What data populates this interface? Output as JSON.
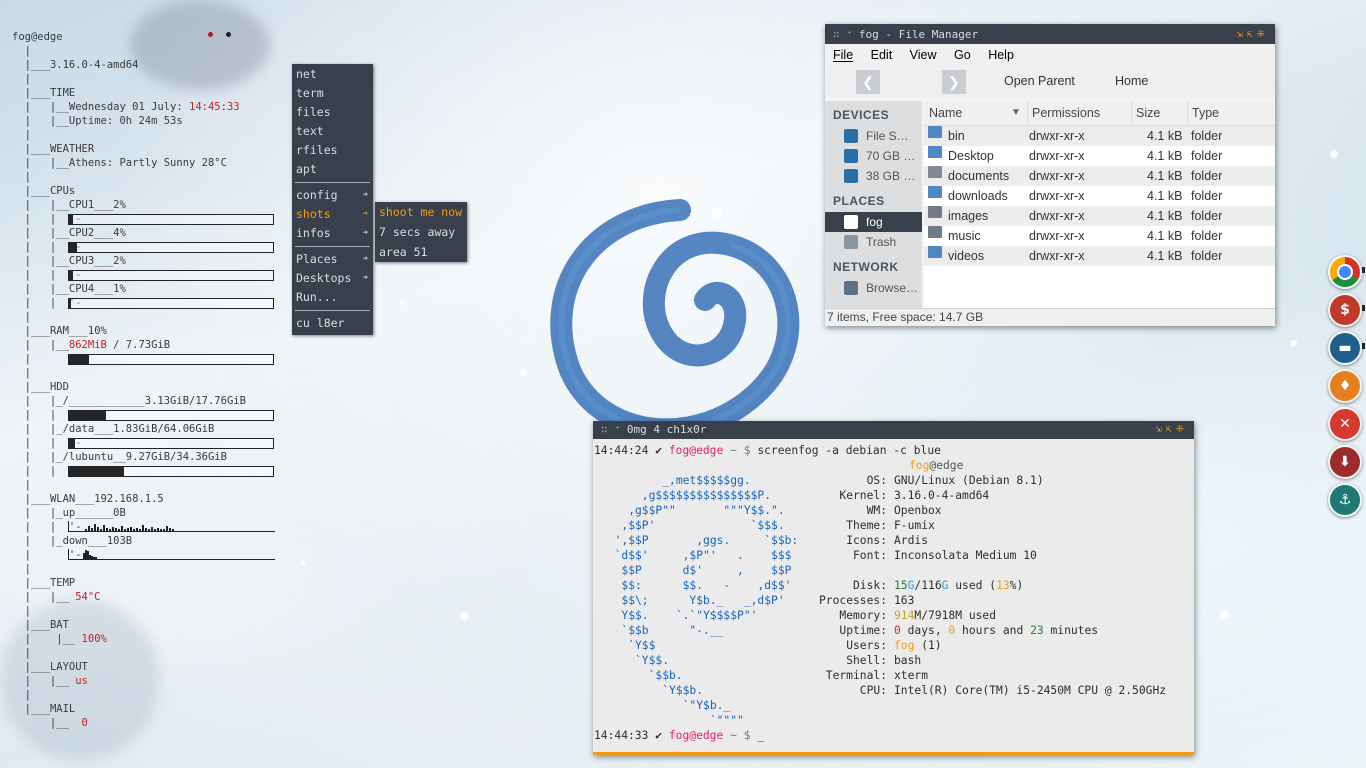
{
  "conky": {
    "host": "fog@edge",
    "kernel": "3.16.0-4-amd64",
    "time_label": "TIME",
    "date_prefix": "Wednesday 01 July: ",
    "time": "14:45:33",
    "uptime": "Uptime: 0h 24m 53s",
    "weather_label": "WEATHER",
    "weather": "Athens: Partly Sunny 28°C",
    "cpus_label": "CPUs",
    "cpus": [
      {
        "label": "CPU1___2%",
        "value": 0.02
      },
      {
        "label": "CPU2___4%",
        "value": 0.04
      },
      {
        "label": "CPU3___2%",
        "value": 0.02
      },
      {
        "label": "CPU4___1%",
        "value": 0.01
      }
    ],
    "ram_label": "RAM___10%",
    "ram_used": "862MiB",
    "ram_total": " / 7.73GiB",
    "ram_value": 0.1,
    "hdd_label": "HDD",
    "disks": [
      {
        "label": "_/____________3.13GiB/17.76GiB",
        "value": 0.18
      },
      {
        "label": "_/data___1.83GiB/64.06GiB",
        "value": 0.03
      },
      {
        "label": "_/lubuntu__9.27GiB/34.36GiB",
        "value": 0.27
      }
    ],
    "wlan_label": "WLAN___192.168.1.5",
    "up_label": "_up______0B",
    "down_label": "_down___103B",
    "temp_label": "TEMP",
    "temp": "54°C",
    "bat_label": "BAT",
    "bat": "100%",
    "layout_label": "LAYOUT",
    "layout": "us",
    "mail_label": "MAIL",
    "mail": "0"
  },
  "menu": {
    "items": [
      "net",
      "term",
      "files",
      "text",
      "rfiles",
      "apt"
    ],
    "sub_items": [
      "config",
      "shots",
      "infos"
    ],
    "places": [
      "Places",
      "Desktops",
      "Run..."
    ],
    "footer": "cu l8er"
  },
  "submenu": {
    "items": [
      "shoot me now",
      "7 secs away",
      "area 51"
    ]
  },
  "file_manager": {
    "title": "fog - File Manager",
    "menus": [
      "File",
      "Edit",
      "View",
      "Go",
      "Help"
    ],
    "toolbar": {
      "open_parent": "Open Parent",
      "home": "Home"
    },
    "devices_head": "DEVICES",
    "devices": [
      "File S…",
      "70 GB …",
      "38 GB …"
    ],
    "places_head": "PLACES",
    "places": [
      "fog",
      "Trash"
    ],
    "network_head": "NETWORK",
    "network": [
      "Browse…"
    ],
    "columns": [
      "Name",
      "Permissions",
      "Size",
      "Type"
    ],
    "rows": [
      {
        "name": "bin",
        "perm": "drwxr-xr-x",
        "size": "4.1 kB",
        "type": "folder",
        "icon": "folder-icon"
      },
      {
        "name": "Desktop",
        "perm": "drwxr-xr-x",
        "size": "4.1 kB",
        "type": "folder",
        "icon": "folder-icon"
      },
      {
        "name": "documents",
        "perm": "drwxr-xr-x",
        "size": "4.1 kB",
        "type": "folder",
        "icon": "document-icon"
      },
      {
        "name": "downloads",
        "perm": "drwxr-xr-x",
        "size": "4.1 kB",
        "type": "folder",
        "icon": "download-icon"
      },
      {
        "name": "images",
        "perm": "drwxr-xr-x",
        "size": "4.1 kB",
        "type": "folder",
        "icon": "image-icon"
      },
      {
        "name": "music",
        "perm": "drwxr-xr-x",
        "size": "4.1 kB",
        "type": "folder",
        "icon": "music-icon"
      },
      {
        "name": "videos",
        "perm": "drwxr-xr-x",
        "size": "4.1 kB",
        "type": "folder",
        "icon": "video-icon"
      }
    ],
    "status": "7 items, Free space: 14.7 GB"
  },
  "terminal": {
    "title": "0mg 4 ch1x0r",
    "prompt1_time": "14:44:24",
    "check": "✔",
    "user_host": "fog@edge",
    "path": "~ $",
    "command": "screenfog -a debian -c blue",
    "header_user": "fog",
    "header_at": "@edge",
    "info": {
      "os_k": "OS:",
      "os_v": "GNU/Linux (Debian 8.1)",
      "kernel_k": "Kernel:",
      "kernel_v": "3.16.0-4-amd64",
      "wm_k": "WM:",
      "wm_v": "Openbox",
      "theme_k": "Theme:",
      "theme_v": "F-umix",
      "icons_k": "Icons:",
      "icons_v": "Ardis",
      "font_k": "Font:",
      "font_v": "Inconsolata Medium 10",
      "disk_k": "Disk:",
      "disk_a": "15",
      "disk_b": "G",
      "disk_c": "/116",
      "disk_d": "G",
      "disk_e": " used (",
      "disk_f": "13",
      "disk_g": "%)",
      "proc_k": "Processes:",
      "proc_v": "163",
      "mem_k": "Memory:",
      "mem_a": "914",
      "mem_b": "M/7918M used",
      "up_k": "Uptime:",
      "up_a": "0",
      "up_b": " days, ",
      "up_c": "0",
      "up_d": " hours and ",
      "up_e": "23",
      "up_f": " minutes",
      "users_k": "Users:",
      "users_a": "fog",
      "users_b": " (1)",
      "shell_k": "Shell:",
      "shell_v": "bash",
      "term_k": "Terminal:",
      "term_v": "xterm",
      "cpu_k": "CPU:",
      "cpu_v": "Intel(R) Core(TM) i5-2450M CPU @ 2.50GHz"
    },
    "logo": [
      "         _,met$$$$$gg.",
      "      ,g$$$$$$$$$$$$$$$P.",
      "    ,g$$P\"\"       \"\"\"Y$$.\".",
      "   ,$$P'              `$$$.",
      "  ',$$P       ,ggs.     `$$b:",
      "  `d$$'     ,$P\"'   .    $$$",
      "   $$P      d$'     ,    $$P",
      "   $$:      $$.   -    ,d$$'",
      "   $$\\;      Y$b._   _,d$P'",
      "   Y$$.    `.`\"Y$$$$P\"'",
      "   `$$b      \"-.__",
      "    `Y$$",
      "     `Y$$.",
      "       `$$b.",
      "         `Y$$b.",
      "            `\"Y$b._",
      "                `\"\"\"\""
    ],
    "prompt2_time": "14:44:33",
    "cursor": "_"
  },
  "dock": [
    "chrome-icon",
    "money-icon",
    "files-icon",
    "flame-icon",
    "close-icon",
    "download-icon",
    "anchor-icon"
  ]
}
